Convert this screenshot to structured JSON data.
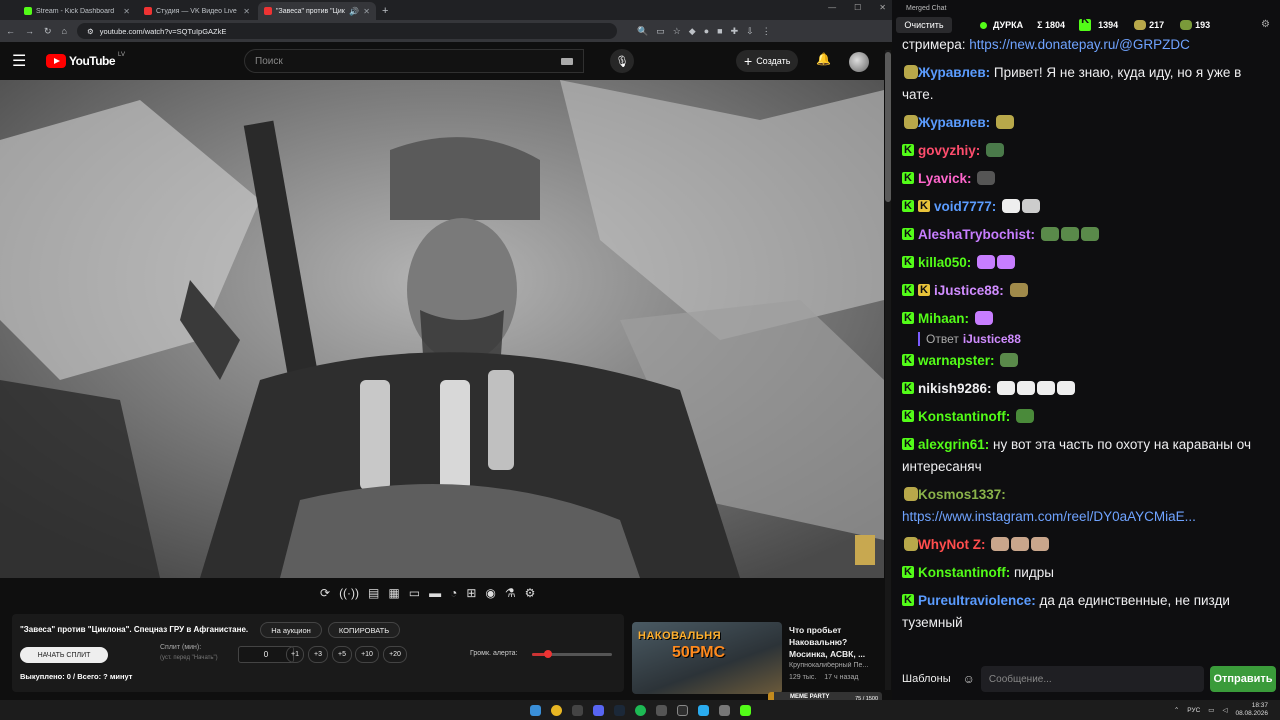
{
  "browser": {
    "tabs": [
      {
        "label": "Stream - Kick Dashboard",
        "color": "#53fc18"
      },
      {
        "label": "Студия — VK Видео Live",
        "color": "#e33"
      },
      {
        "label": "\"Завеса\" против \"Циклона\"",
        "color": "#e33"
      }
    ],
    "url": "youtube.com/watch?v=SQTuIpGAZkE"
  },
  "youtube": {
    "logo": "YouTube",
    "country": "LV",
    "search_placeholder": "Поиск",
    "create_label": "Создать"
  },
  "panel": {
    "title": "\"Завеса\" против \"Циклона\". Спецназ ГРУ в Афганистане.",
    "auction_btn": "На аукцион",
    "copy_btn": "КОПИРОВАТЬ",
    "start_split": "НАЧАТЬ СПЛИТ",
    "split_label": "Сплит (мин):",
    "split_hint": "(уст. перед \"Начать\")",
    "split_value": "0",
    "increments": [
      "+1",
      "+3",
      "+5",
      "+10",
      "+20"
    ],
    "volume_label": "Громк. алерта:",
    "volume_level": 0.2,
    "bought": "Выкуплено: 0 / Всего: ? минут"
  },
  "recommendation": {
    "thumb_line1": "НАКОВАЛЬНЯ",
    "thumb_line2": "50РМС",
    "title": "Что пробьет Наковальню? Мосинка, АСВК, ...",
    "channel": "Крупнокалиберный Пе...",
    "views": "129 тыс.",
    "age": "17 ч назад"
  },
  "meme": {
    "label": "MEME PARTY",
    "count": "75 / 1500",
    "progress": 0.05
  },
  "chat": {
    "window_title": "Merged Chat",
    "clear": "Очистить",
    "stream_name": "ДУРКА",
    "stat_total": "Σ 1804",
    "stat_kick": "1394",
    "stat_b": "217",
    "stat_c": "193",
    "messages": [
      {
        "user": "",
        "text": "стримера: ",
        "link": "https://new.donatepay.ru/@GRPZDC",
        "badge": "",
        "color": "#efeff1"
      },
      {
        "user": "Журавлев",
        "text": "Привет! Я не знаю, куда иду, но я уже в чате.",
        "link": "",
        "badge": "pepe",
        "color": "#5b9cff"
      },
      {
        "user": "Журавлев",
        "text": "",
        "link": "",
        "badge": "pepe",
        "color": "#5b9cff",
        "emotes": [
          "#b8a84a"
        ]
      },
      {
        "user": "govyzhiy",
        "text": "",
        "link": "",
        "badge": "kick",
        "color": "#ff4d6d",
        "emotes": [
          "#4a7a4a"
        ]
      },
      {
        "user": "Lyavick",
        "text": "",
        "link": "",
        "badge": "kick",
        "color": "#ff66cc",
        "emotes": [
          "#555"
        ]
      },
      {
        "user": "void7777",
        "text": "",
        "link": "",
        "badge": "kick2",
        "color": "#5b9cff",
        "emotes": [
          "#eee",
          "#ccc"
        ]
      },
      {
        "user": "AleshaTrybochist",
        "text": "",
        "link": "",
        "badge": "kick",
        "color": "#c77dff",
        "emotes": [
          "#5a8a4a",
          "#5a8a4a",
          "#5a8a4a"
        ]
      },
      {
        "user": "killa050",
        "text": "",
        "link": "",
        "badge": "kick",
        "color": "#53fc18",
        "emotes": [
          "#c77dff",
          "#c77dff"
        ]
      },
      {
        "user": "iJustice88",
        "text": "",
        "link": "",
        "badge": "kick2",
        "color": "#d08cff",
        "emotes": [
          "#a08a4a"
        ]
      },
      {
        "user": "Mihaan",
        "text": "",
        "link": "",
        "badge": "kick",
        "color": "#53fc18",
        "emotes": [
          "#c77dff"
        ]
      },
      {
        "user": "warnapster",
        "text": "",
        "link": "",
        "badge": "kick",
        "color": "#53fc18",
        "emotes": [
          "#5a8a4a"
        ]
      },
      {
        "user": "nikish9286",
        "text": "",
        "link": "",
        "badge": "kick",
        "color": "#efeff1",
        "emotes": [
          "#eee",
          "#eee",
          "#eee",
          "#eee"
        ]
      },
      {
        "user": "Konstantinoff",
        "text": "",
        "link": "",
        "badge": "kick",
        "color": "#53fc18",
        "emotes": [
          "#4a8a3a"
        ]
      },
      {
        "user": "alexgrin61",
        "text": "ну вот эта часть по охоту на караваны оч интересаняч",
        "link": "",
        "badge": "kick",
        "color": "#53fc18"
      },
      {
        "user": "Kosmos1337",
        "text": "",
        "link": "https://www.instagram.com/reel/DY0aAYCMiaE...",
        "badge": "pepe",
        "color": "#8ab34a"
      },
      {
        "user": "WhyNot Z",
        "text": "",
        "link": "",
        "badge": "pepe",
        "color": "#ff4d4d",
        "emotes": [
          "#c9a68c",
          "#c9a68c",
          "#c9a68c"
        ]
      },
      {
        "user": "Konstantinoff",
        "text": "пидры",
        "link": "",
        "badge": "kick",
        "color": "#53fc18"
      },
      {
        "user": "PureuItraviolence",
        "text": "да да единственные, не пизди туземный",
        "link": "",
        "badge": "kick",
        "color": "#5b9cff"
      }
    ],
    "reply": {
      "prefix": "Ответ",
      "user": "iJustice88"
    },
    "templates": "Шаблоны",
    "input_placeholder": "Сообщение...",
    "send": "Отправить"
  },
  "taskbar": {
    "lang": "РУС",
    "time": "18:37",
    "date": "08.08.2026"
  }
}
